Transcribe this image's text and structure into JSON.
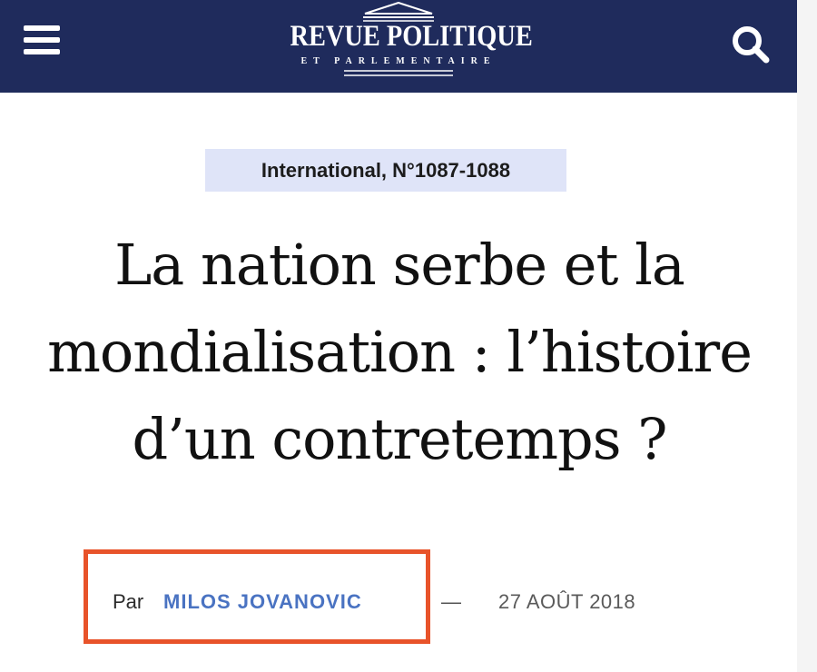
{
  "header": {
    "logo_main": "REVUE POLITIQUE",
    "logo_sub": "ET PARLEMENTAIRE",
    "menu_icon": "menu-icon",
    "search_icon": "search-icon",
    "background_color": "#1f2b5c"
  },
  "article": {
    "category": "International, N°1087-1088",
    "title": "La nation serbe et la mondialisation : l’histoire d’un contretemps ?",
    "byline": {
      "prefix": "Par",
      "author": "MILOS JOVANOVIC",
      "separator": "—",
      "date": "27 AOÛT 2018"
    }
  },
  "colors": {
    "category_background": "#dfe4f8",
    "author_link": "#4a73c2",
    "highlight_border": "#e8532a"
  }
}
